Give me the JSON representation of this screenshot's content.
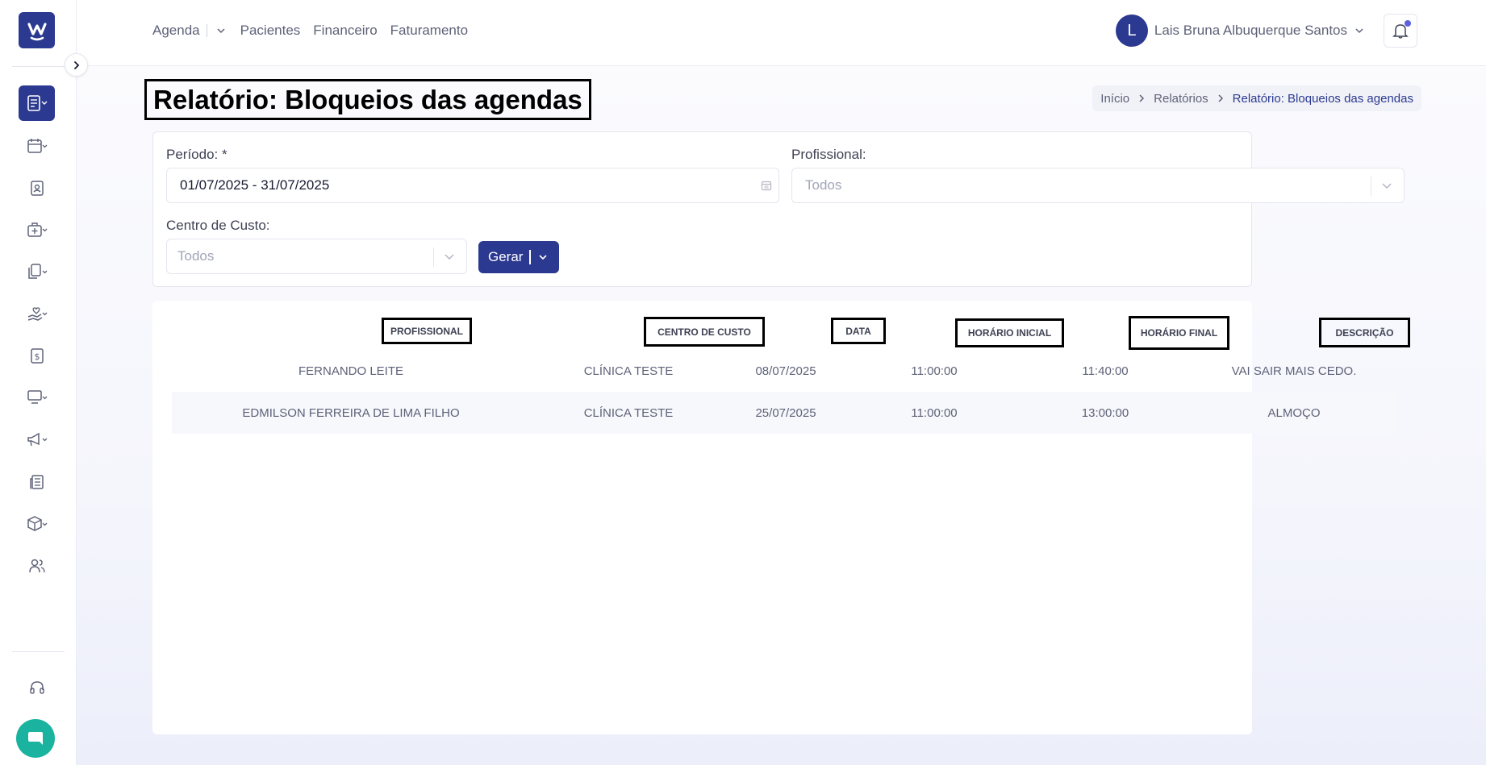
{
  "topbar": {
    "nav": [
      "Agenda",
      "Pacientes",
      "Financeiro",
      "Faturamento"
    ],
    "user_initial": "L",
    "user_name": "Lais Bruna Albuquerque Santos"
  },
  "page": {
    "title": "Relatório: Bloqueios das agendas",
    "breadcrumb": [
      "Início",
      "Relatórios",
      "Relatório: Bloqueios das agendas"
    ]
  },
  "filters": {
    "periodo_label": "Período: *",
    "periodo_value": "01/07/2025 - 31/07/2025",
    "profissional_label": "Profissional:",
    "profissional_value": "Todos",
    "centro_label": "Centro de Custo:",
    "centro_value": "Todos",
    "gerar_label": "Gerar"
  },
  "table": {
    "columns": [
      "PROFISSIONAL",
      "CENTRO DE CUSTO",
      "DATA",
      "HORÁRIO INICIAL",
      "HORÁRIO FINAL",
      "DESCRIÇÃO"
    ],
    "rows": [
      [
        "FERNANDO LEITE",
        "CLÍNICA TESTE",
        "08/07/2025",
        "11:00:00",
        "11:40:00",
        "VAI SAIR MAIS CEDO."
      ],
      [
        "EDMILSON FERREIRA DE LIMA FILHO",
        "CLÍNICA TESTE",
        "25/07/2025",
        "11:00:00",
        "13:00:00",
        "ALMOÇO"
      ]
    ]
  },
  "colors": {
    "brand": "#2b3990",
    "chat": "#19b3a0",
    "notification_dot": "#5b5fe0"
  }
}
